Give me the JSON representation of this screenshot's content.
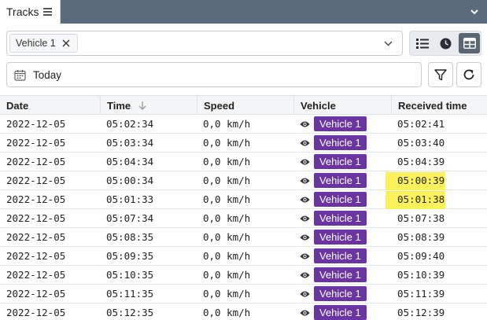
{
  "tab": {
    "title": "Tracks"
  },
  "vehicle_filter": {
    "chip_label": "Vehicle 1"
  },
  "date_filter": {
    "label": "Today"
  },
  "table": {
    "columns": [
      "Date",
      "Time",
      "Speed",
      "Vehicle",
      "Received time"
    ],
    "sort": {
      "column": "Time",
      "direction": "descending"
    },
    "rows": [
      {
        "date": "2022-12-05",
        "time": "05:02:34",
        "speed": "0,0 km/h",
        "vehicle": "Vehicle 1",
        "received": "05:02:41",
        "highlight": false
      },
      {
        "date": "2022-12-05",
        "time": "05:03:34",
        "speed": "0,0 km/h",
        "vehicle": "Vehicle 1",
        "received": "05:03:40",
        "highlight": false
      },
      {
        "date": "2022-12-05",
        "time": "05:04:34",
        "speed": "0,0 km/h",
        "vehicle": "Vehicle 1",
        "received": "05:04:39",
        "highlight": false
      },
      {
        "date": "2022-12-05",
        "time": "05:00:34",
        "speed": "0,0 km/h",
        "vehicle": "Vehicle 1",
        "received": "05:00:39",
        "highlight": true
      },
      {
        "date": "2022-12-05",
        "time": "05:01:33",
        "speed": "0,0 km/h",
        "vehicle": "Vehicle 1",
        "received": "05:01:38",
        "highlight": true
      },
      {
        "date": "2022-12-05",
        "time": "05:07:34",
        "speed": "0,0 km/h",
        "vehicle": "Vehicle 1",
        "received": "05:07:38",
        "highlight": false
      },
      {
        "date": "2022-12-05",
        "time": "05:08:35",
        "speed": "0,0 km/h",
        "vehicle": "Vehicle 1",
        "received": "05:08:39",
        "highlight": false
      },
      {
        "date": "2022-12-05",
        "time": "05:09:35",
        "speed": "0,0 km/h",
        "vehicle": "Vehicle 1",
        "received": "05:09:40",
        "highlight": false
      },
      {
        "date": "2022-12-05",
        "time": "05:10:35",
        "speed": "0,0 km/h",
        "vehicle": "Vehicle 1",
        "received": "05:10:39",
        "highlight": false
      },
      {
        "date": "2022-12-05",
        "time": "05:11:35",
        "speed": "0,0 km/h",
        "vehicle": "Vehicle 1",
        "received": "05:11:39",
        "highlight": false
      },
      {
        "date": "2022-12-05",
        "time": "05:12:35",
        "speed": "0,0 km/h",
        "vehicle": "Vehicle 1",
        "received": "05:12:39",
        "highlight": false
      }
    ]
  },
  "colors": {
    "titlebar": "#5b6b7b",
    "vehicle_badge": "#6a35a3",
    "highlight": "#fbf25b",
    "active_view_button": "#5b6673"
  },
  "icons": {
    "tab_menu": "hamburger-icon",
    "window_menu": "chevron-down-icon",
    "chip_remove": "close-icon",
    "select_dropdown": "chevron-down-icon",
    "view_list": "list-icon",
    "view_history": "clock-icon",
    "view_table": "table-icon",
    "date": "calendar-icon",
    "filter": "filter-icon",
    "refresh": "refresh-icon",
    "sort": "arrow-down-icon",
    "visibility": "eye-icon"
  }
}
